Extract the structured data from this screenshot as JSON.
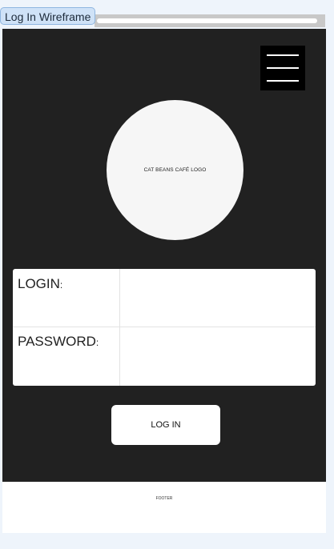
{
  "frame": {
    "title": "Log In Wireframe"
  },
  "header": {
    "menu_icon": "hamburger-menu-icon"
  },
  "logo": {
    "text": "CAT BEANS CAFÉ LOGO"
  },
  "form": {
    "login_label": "LOGIN",
    "password_label": "PASSWORD",
    "colon": ":",
    "login_value": "",
    "password_value": ""
  },
  "actions": {
    "login_button_label": "LOG IN"
  },
  "footer": {
    "text": "FOOTER"
  },
  "colors": {
    "screen_background": "#212121",
    "surface": "#ffffff",
    "logo_fill": "#f6f6f6",
    "menu_button": "#000000",
    "frame_tab": "#cfe2f7"
  }
}
